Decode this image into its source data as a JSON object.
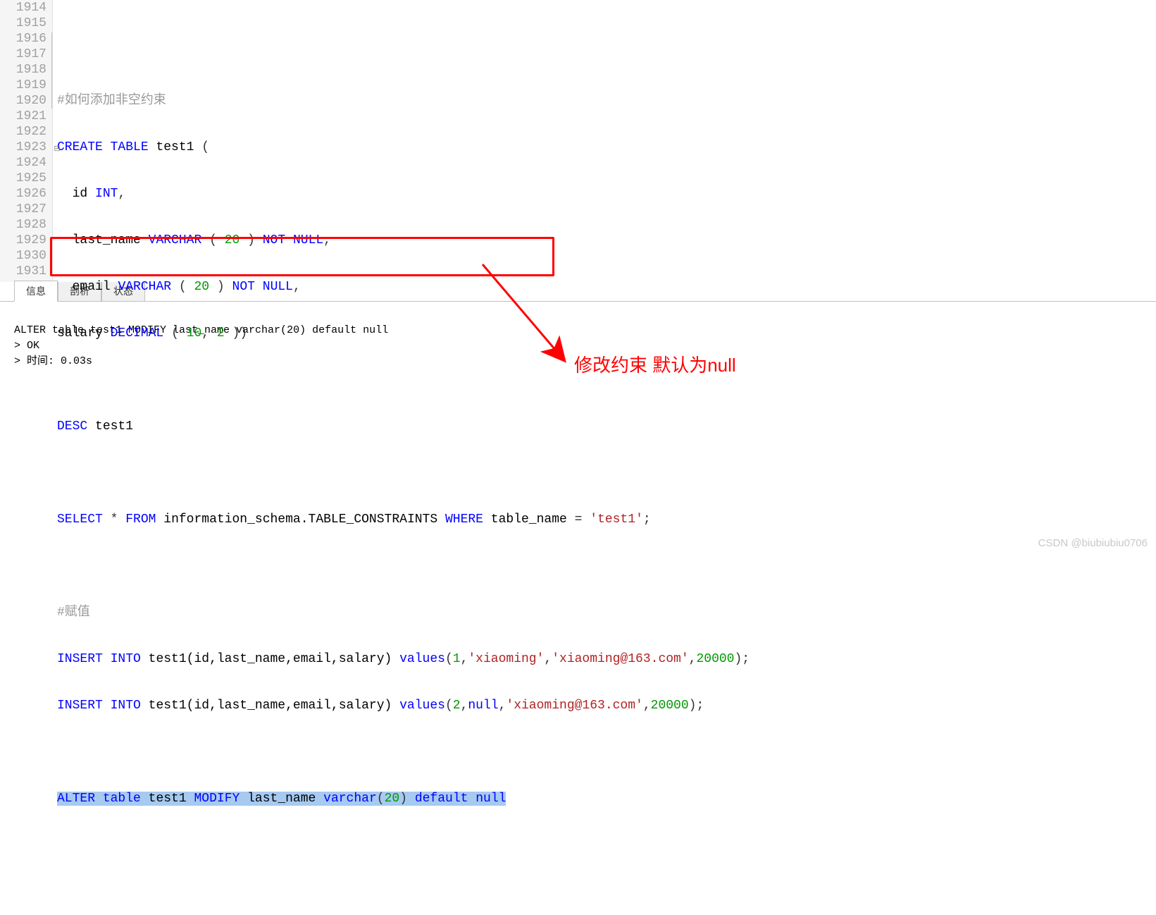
{
  "gutter": [
    "1914",
    "1915",
    "1916",
    "1917",
    "1918",
    "1919",
    "1920",
    "1921",
    "1922",
    "1923",
    "1924",
    "1925",
    "1926",
    "1927",
    "1928",
    "1929",
    "1930",
    "1931"
  ],
  "code": {
    "l1915": {
      "comment": "#如何添加非空约束"
    },
    "l1916": {
      "kw1": "CREATE",
      "kw2": "TABLE",
      "ident": "test1",
      "paren": "("
    },
    "l1917": {
      "ident": "id",
      "type": "INT",
      "comma": ","
    },
    "l1918": {
      "ident": "last_name",
      "type": "VARCHAR",
      "lp": "(",
      "n": "20",
      "rp": ")",
      "kw1": "NOT",
      "kw2": "NULL",
      "comma": ","
    },
    "l1919": {
      "ident": "email",
      "type": "VARCHAR",
      "lp": "(",
      "n": "20",
      "rp": ")",
      "kw1": "NOT",
      "kw2": "NULL",
      "comma": ","
    },
    "l1920": {
      "ident": "salary",
      "type": "DECIMAL",
      "lp": "(",
      "n1": "10",
      "comma1": ",",
      "n2": "2",
      "rp": "))"
    },
    "l1922": {
      "kw": "DESC",
      "ident": "test1"
    },
    "l1924": {
      "kw1": "SELECT",
      "star": "*",
      "kw2": "FROM",
      "ident": "information_schema.TABLE_CONSTRAINTS",
      "kw3": "WHERE",
      "col": "table_name",
      "eq": "=",
      "str": "'test1'",
      "semi": ";"
    },
    "l1926": {
      "comment": "#赋值"
    },
    "l1927": {
      "kw1": "INSERT",
      "kw2": "INTO",
      "ident": "test1(id,last_name,email,salary)",
      "kw3": "values",
      "lp": "(",
      "n1": "1",
      "c1": ",",
      "s1": "'xiaoming'",
      "c2": ",",
      "s2": "'xiaoming@163.com'",
      "c3": ",",
      "n2": "20000",
      "rp": ");"
    },
    "l1928": {
      "kw1": "INSERT",
      "kw2": "INTO",
      "ident": "test1(id,last_name,email,salary)",
      "kw3": "values",
      "lp": "(",
      "n1": "2",
      "c1": ",",
      "kw4": "null",
      "c2": ",",
      "s2": "'xiaoming@163.com'",
      "c3": ",",
      "n2": "20000",
      "rp": ");"
    },
    "l1930": {
      "kw1": "ALTER",
      "kw2": "table",
      "ident": "test1",
      "kw3": "MODIFY",
      "col": "last_name",
      "type": "varchar",
      "lp": "(",
      "n": "20",
      "rp": ")",
      "kw4": "default",
      "kw5": "null"
    }
  },
  "tabs": {
    "t1": "信息",
    "t2": "剖析",
    "t3": "状态"
  },
  "output": {
    "line1": "ALTER table test1 MODIFY last_name varchar(20) default null",
    "line2": "> OK",
    "line3": "> 时间: 0.03s"
  },
  "annotation": "修改约束  默认为null",
  "watermark": "CSDN @biubiubiu0706"
}
